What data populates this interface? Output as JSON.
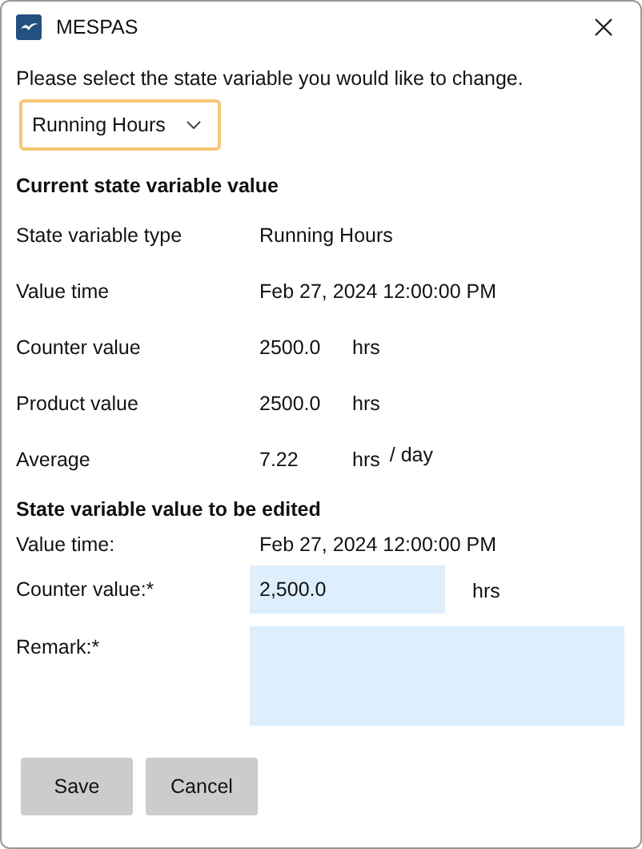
{
  "window": {
    "title": "MESPAS"
  },
  "prompt": "Please select the state variable you would like to change.",
  "selector": {
    "value": "Running Hours",
    "focused": true
  },
  "current": {
    "heading": "Current state variable value",
    "rows": [
      {
        "label": "State variable type",
        "value": "Running Hours"
      },
      {
        "label": "Value time",
        "value": "Feb 27, 2024 12:00:00 PM"
      },
      {
        "label": "Counter value",
        "value": "2500.0",
        "unit": "hrs"
      },
      {
        "label": "Product value",
        "value": "2500.0",
        "unit": "hrs"
      },
      {
        "label": "Average",
        "value": "7.22",
        "unit": "hrs",
        "per": "/ day"
      }
    ]
  },
  "edit": {
    "heading": "State variable value to be edited",
    "value_time": {
      "label": "Value time:",
      "value": "Feb 27, 2024 12:00:00 PM"
    },
    "counter": {
      "label": "Counter value:*",
      "value": "2,500.0",
      "unit": "hrs"
    },
    "remark": {
      "label": "Remark:*"
    }
  },
  "buttons": [
    "Save",
    "Cancel"
  ]
}
